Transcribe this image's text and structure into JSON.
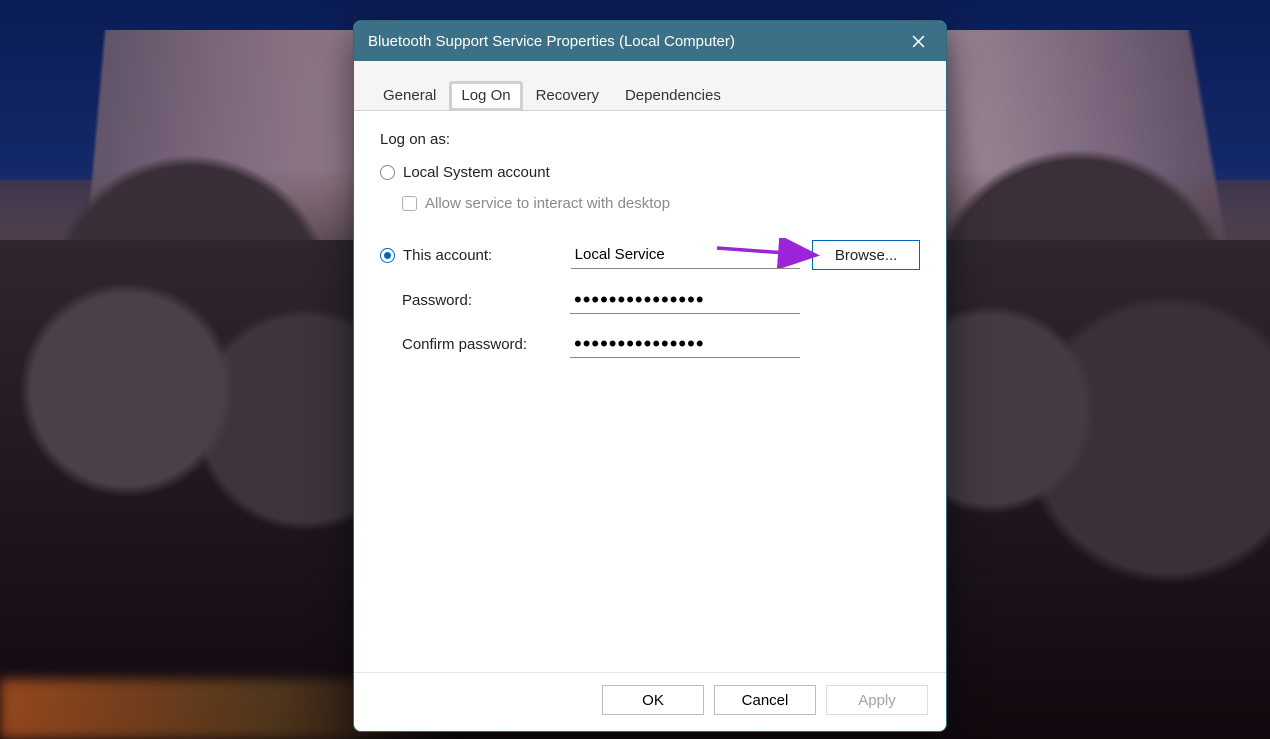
{
  "window": {
    "title": "Bluetooth Support Service Properties (Local Computer)"
  },
  "tabs": {
    "general": "General",
    "log_on": "Log On",
    "recovery": "Recovery",
    "dependencies": "Dependencies",
    "active": "log_on"
  },
  "logon": {
    "section_label": "Log on as:",
    "local_system_label": "Local System account",
    "interact_label": "Allow service to interact with desktop",
    "this_account_label": "This account:",
    "account_value": "Local Service",
    "browse_label": "Browse...",
    "password_label": "Password:",
    "password_value": "•••••••••••••••",
    "confirm_label": "Confirm password:",
    "confirm_value": "•••••••••••••••",
    "selected": "this_account"
  },
  "footer": {
    "ok": "OK",
    "cancel": "Cancel",
    "apply": "Apply"
  },
  "annotations": {
    "tab_highlight": "log_on",
    "arrow_target": "browse-button",
    "arrow_color": "#9a24d6"
  }
}
